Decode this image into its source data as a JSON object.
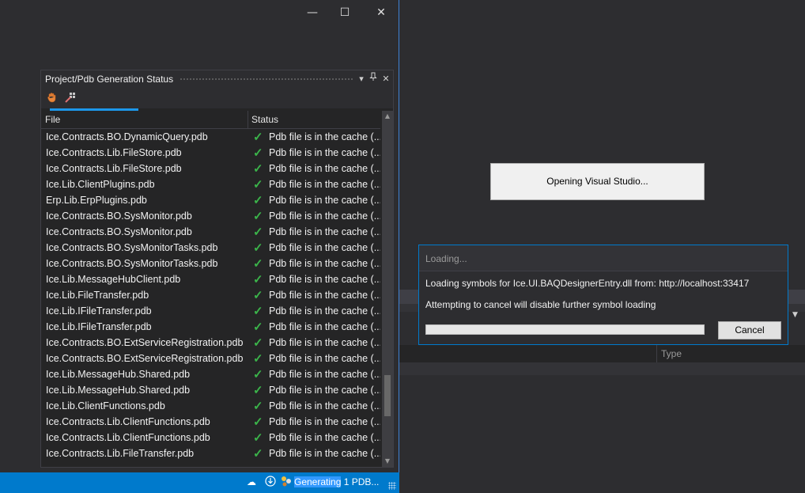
{
  "window": {
    "minimize_glyph": "—",
    "maximize_glyph": "☐",
    "close_glyph": "✕"
  },
  "panel": {
    "title": "Project/Pdb Generation Status",
    "columns": {
      "file": "File",
      "status": "Status"
    },
    "rows": [
      {
        "file": "Ice.Contracts.BO.DynamicQuery.pdb",
        "status": "Pdb file is in the cache (..."
      },
      {
        "file": "Ice.Contracts.Lib.FileStore.pdb",
        "status": "Pdb file is in the cache (..."
      },
      {
        "file": "Ice.Contracts.Lib.FileStore.pdb",
        "status": "Pdb file is in the cache (..."
      },
      {
        "file": "Ice.Lib.ClientPlugins.pdb",
        "status": "Pdb file is in the cache (..."
      },
      {
        "file": "Erp.Lib.ErpPlugins.pdb",
        "status": "Pdb file is in the cache (..."
      },
      {
        "file": "Ice.Contracts.BO.SysMonitor.pdb",
        "status": "Pdb file is in the cache (..."
      },
      {
        "file": "Ice.Contracts.BO.SysMonitor.pdb",
        "status": "Pdb file is in the cache (..."
      },
      {
        "file": "Ice.Contracts.BO.SysMonitorTasks.pdb",
        "status": "Pdb file is in the cache (..."
      },
      {
        "file": "Ice.Contracts.BO.SysMonitorTasks.pdb",
        "status": "Pdb file is in the cache (..."
      },
      {
        "file": "Ice.Lib.MessageHubClient.pdb",
        "status": "Pdb file is in the cache (..."
      },
      {
        "file": "Ice.Lib.FileTransfer.pdb",
        "status": "Pdb file is in the cache (..."
      },
      {
        "file": "Ice.Lib.IFileTransfer.pdb",
        "status": "Pdb file is in the cache (..."
      },
      {
        "file": "Ice.Lib.IFileTransfer.pdb",
        "status": "Pdb file is in the cache (..."
      },
      {
        "file": "Ice.Contracts.BO.ExtServiceRegistration.pdb",
        "status": "Pdb file is in the cache (..."
      },
      {
        "file": "Ice.Contracts.BO.ExtServiceRegistration.pdb",
        "status": "Pdb file is in the cache (..."
      },
      {
        "file": "Ice.Lib.MessageHub.Shared.pdb",
        "status": "Pdb file is in the cache (..."
      },
      {
        "file": "Ice.Lib.MessageHub.Shared.pdb",
        "status": "Pdb file is in the cache (..."
      },
      {
        "file": "Ice.Lib.ClientFunctions.pdb",
        "status": "Pdb file is in the cache (..."
      },
      {
        "file": "Ice.Contracts.Lib.ClientFunctions.pdb",
        "status": "Pdb file is in the cache (..."
      },
      {
        "file": "Ice.Contracts.Lib.ClientFunctions.pdb",
        "status": "Pdb file is in the cache (..."
      },
      {
        "file": "Ice.Contracts.Lib.FileTransfer.pdb",
        "status": "Pdb file is in the cache (..."
      }
    ],
    "check_glyph": "✓",
    "accent_color": "#1c97ea"
  },
  "status_bar": {
    "text_highlight": "Generating",
    "text_rest": " 1 PDB...",
    "color": "#007acc"
  },
  "opening": {
    "text": "Opening Visual Studio..."
  },
  "background": {
    "type_label": "Type"
  },
  "loading_dialog": {
    "title": "Loading...",
    "line1": "Loading symbols for Ice.UI.BAQDesignerEntry.dll from: http://localhost:33417",
    "line2": "Attempting to cancel will disable further symbol loading",
    "cancel_label": "Cancel",
    "progress": 0.0
  }
}
